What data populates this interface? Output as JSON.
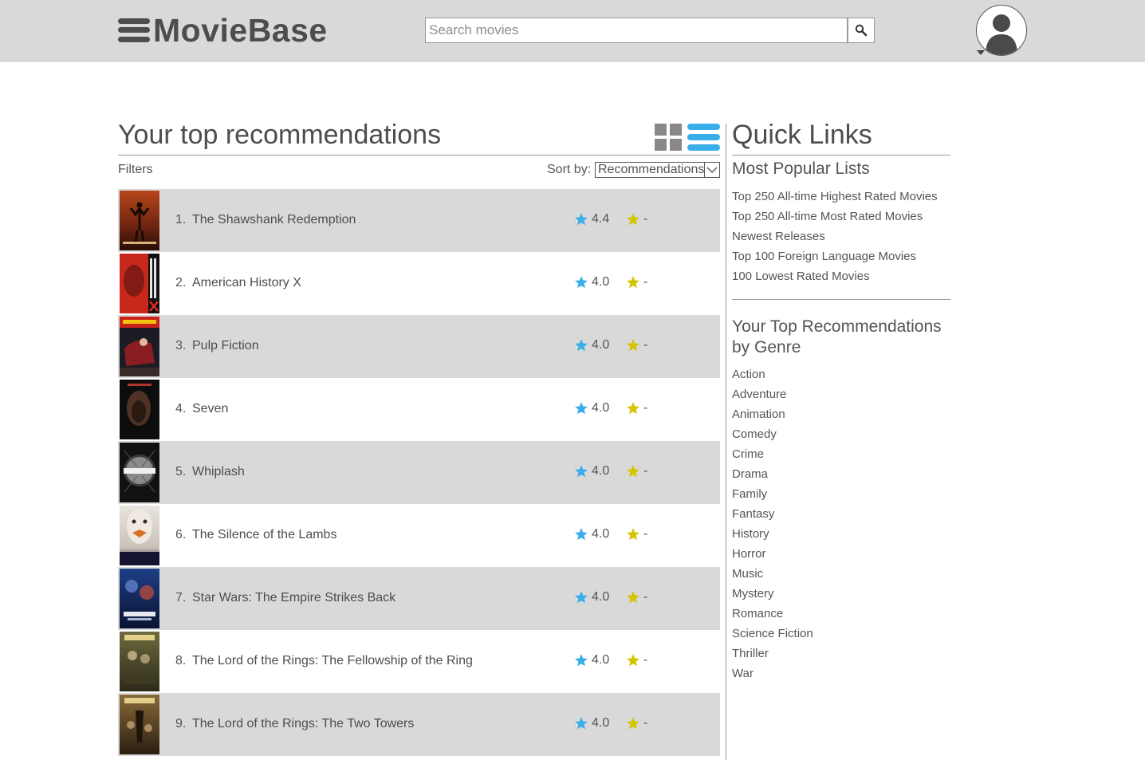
{
  "header": {
    "logo_text": "MovieBase",
    "search_placeholder": "Search movies"
  },
  "recommendations": {
    "title": "Your top recommendations",
    "filters_label": "Filters",
    "sort_label": "Sort by:",
    "sort_value": "Recommendations",
    "movies": [
      {
        "num": "1.",
        "title": "The Shawshank Redemption",
        "rating": "4.4",
        "user_rating": "-"
      },
      {
        "num": "2.",
        "title": "American History X",
        "rating": "4.0",
        "user_rating": "-"
      },
      {
        "num": "3.",
        "title": "Pulp Fiction",
        "rating": "4.0",
        "user_rating": "-"
      },
      {
        "num": "4.",
        "title": "Seven",
        "rating": "4.0",
        "user_rating": "-"
      },
      {
        "num": "5.",
        "title": "Whiplash",
        "rating": "4.0",
        "user_rating": "-"
      },
      {
        "num": "6.",
        "title": "The Silence of the Lambs",
        "rating": "4.0",
        "user_rating": "-"
      },
      {
        "num": "7.",
        "title": "Star Wars: The Empire Strikes Back",
        "rating": "4.0",
        "user_rating": "-"
      },
      {
        "num": "8.",
        "title": "The Lord of the Rings: The Fellowship of the Ring",
        "rating": "4.0",
        "user_rating": "-"
      },
      {
        "num": "9.",
        "title": "The Lord of the Rings: The Two Towers",
        "rating": "4.0",
        "user_rating": "-"
      }
    ]
  },
  "quick_links": {
    "title": "Quick Links",
    "popular_title": "Most Popular Lists",
    "popular": [
      "Top 250 All-time Highest Rated Movies",
      "Top 250 All-time Most Rated Movies",
      "Newest Releases",
      "Top 100 Foreign Language Movies",
      "100 Lowest Rated Movies"
    ],
    "genre_title": "Your Top Recommendations by Genre",
    "genres": [
      "Action",
      "Adventure",
      "Animation",
      "Comedy",
      "Crime",
      "Drama",
      "Family",
      "Fantasy",
      "History",
      "Horror",
      "Music",
      "Mystery",
      "Romance",
      "Science Fiction",
      "Thriller",
      "War"
    ]
  },
  "colors": {
    "header_bg": "#d9d9d9",
    "accent_blue": "#3aaee9",
    "user_star": "#d4c400",
    "row_alt": "#d9d9d9"
  }
}
